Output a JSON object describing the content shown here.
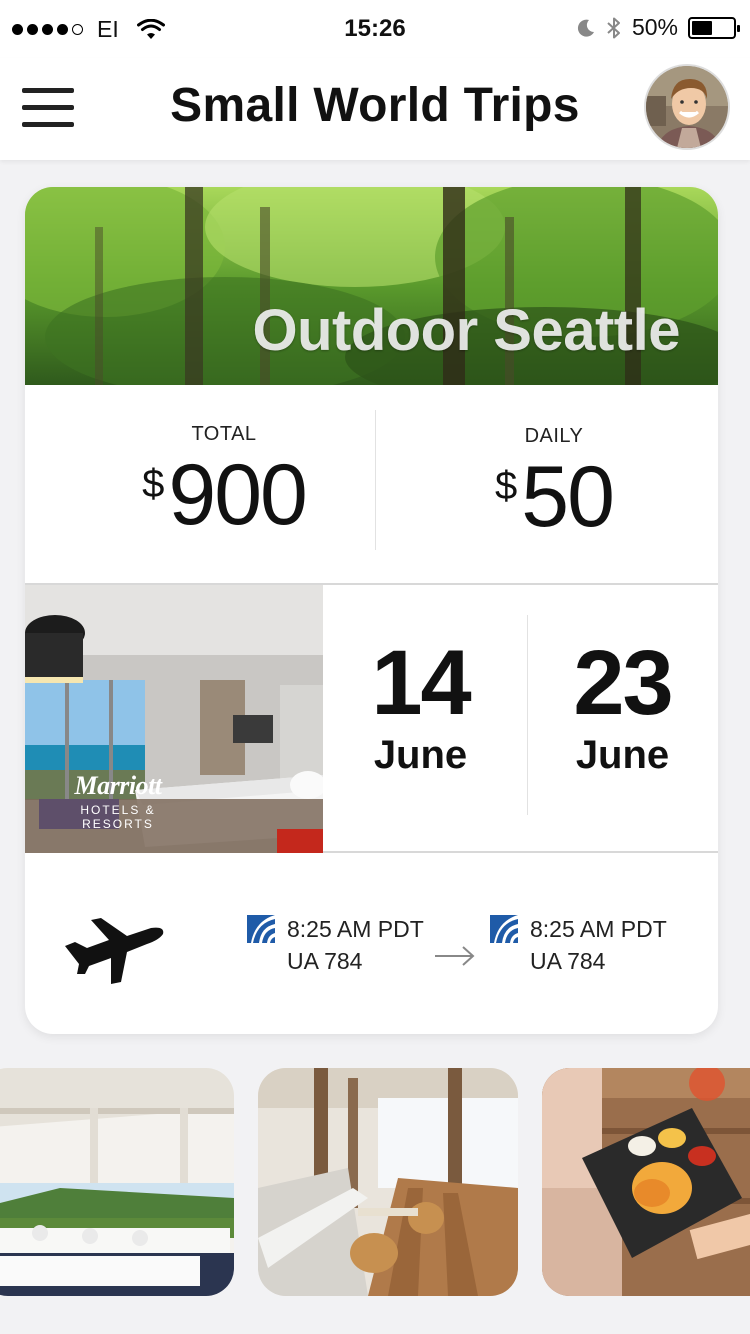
{
  "status_bar": {
    "carrier": "EI",
    "time": "15:26",
    "battery": "50%",
    "battery_level": 0.5
  },
  "header": {
    "title": "Small World Trips"
  },
  "trip": {
    "name": "Outdoor Seattle",
    "total_label": "TOTAL",
    "total_currency": "$",
    "total_amount": "900",
    "daily_label": "DAILY",
    "daily_currency": "$",
    "daily_amount": "50",
    "hotel": {
      "brand": "Marriott",
      "brand_sub": "HOTELS & RESORTS"
    },
    "start": {
      "day": "14",
      "month": "June"
    },
    "end": {
      "day": "23",
      "month": "June"
    },
    "outbound": {
      "time": "8:25 AM PDT",
      "flight": "UA 784"
    },
    "return": {
      "time": "8:25 AM PDT",
      "flight": "UA 784"
    }
  },
  "colors": {
    "airline_blue": "#1f5ba8",
    "forest_green": "#4e8a2a"
  },
  "icons": {
    "menu": "hamburger-icon",
    "plane": "airplane-icon",
    "arrow": "arrow-right-icon",
    "airline": "united-globe-icon"
  }
}
